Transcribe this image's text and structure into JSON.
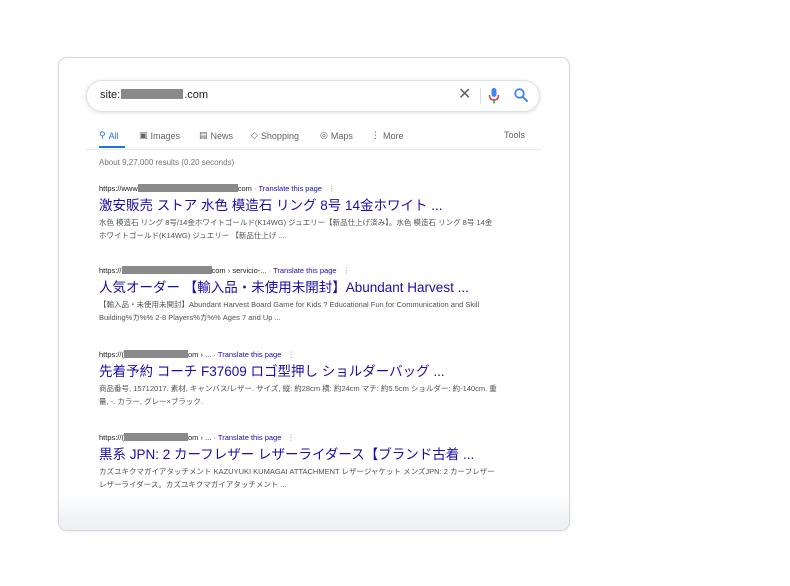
{
  "search": {
    "query_prefix": "site:",
    "query_suffix": ".com"
  },
  "tabs": [
    {
      "label": "All",
      "icon": "search-icon"
    },
    {
      "label": "Images",
      "icon": "image-icon"
    },
    {
      "label": "News",
      "icon": "news-icon"
    },
    {
      "label": "Shopping",
      "icon": "tag-icon"
    },
    {
      "label": "Maps",
      "icon": "pin-icon"
    },
    {
      "label": "More",
      "icon": "more-vert-icon"
    }
  ],
  "tools_label": "Tools",
  "stats": "About 9,27,000 results (0.20 seconds)",
  "results": [
    {
      "cite_prefix": "https://www",
      "cite_suffix": "com",
      "sep": " · ",
      "translate": "Translate this page",
      "title": "激安販売 ストア 水色 模造石 リング 8号 14金ホワイト ...",
      "snippet": "水色 模造石 リング 8号/14金ホワイトゴールド(K14WG) ジュエリー【新品仕上げ済み】。水色 模造石 リング 8号 14金ホワイトゴールド(K14WG) ジュエリー 【新品仕上げ ..."
    },
    {
      "cite_prefix": "https://",
      "cite_suffix": "com › servicio-... ",
      "sep": "· ",
      "translate": "Translate this page",
      "title": "人気オーダー 【輸入品・未使用未開封】Abundant Harvest ...",
      "snippet": "【輸入品・未使用未開封】Abundant Harvest Board Game for Kids ? Educational Fun for Communication and Skill Building%カ%% 2-8 Players%カ%% Ages 7 and Up ..."
    },
    {
      "cite_prefix": "https://(",
      "cite_suffix": "om › ... ",
      "sep": "· ",
      "translate": "Translate this page",
      "title": "先着予約 コーチ F37609 ロゴ型押し ショルダーバッグ ...",
      "snippet": "商品番号, 15712017. 素材, キャンバス/レザー. サイズ, 縦: 約28cm 横: 約24cm マチ: 約5.5cm ショルダー: 約-140cm. 重量, -. カラー, グレー×ブラック."
    },
    {
      "cite_prefix": "https://(",
      "cite_suffix": "om › ... ",
      "sep": "· ",
      "translate": "Translate this page",
      "title": "黒系 JPN: 2 カーフレザー レザーライダース【ブランド古着 ...",
      "snippet": "カズユキクマガイアタッチメント KAZUYUKI KUMAGAI ATTACHMENT レザージャケット メンズJPN: 2 カーフレザー レザーライダース。カズユキクマガイアタッチメント ..."
    }
  ],
  "colors": {
    "link": "#1a0dab",
    "accent": "#1a73e8",
    "mic_red": "#ea4335",
    "mic_blue": "#4285f4"
  }
}
